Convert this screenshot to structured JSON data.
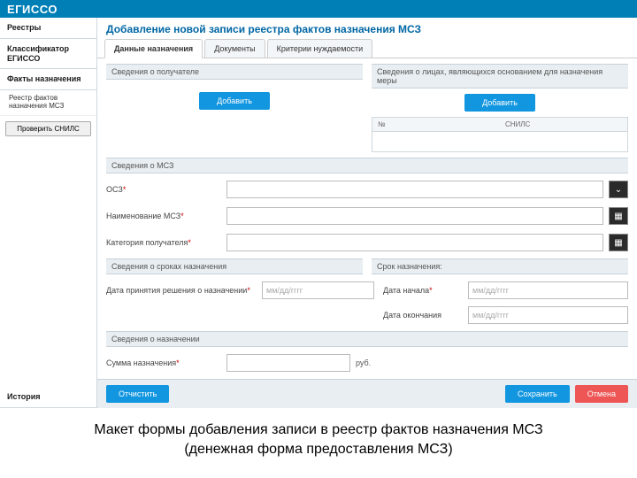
{
  "brand": "ЕГИССО",
  "sidebar": {
    "items": [
      {
        "label": "Реестры"
      },
      {
        "label": "Классификатор ЕГИССО"
      },
      {
        "label": "Факты назначения"
      }
    ],
    "sub_item": "Реестр фактов назначения МСЗ",
    "check_btn": "Проверить СНИЛС",
    "history": "История"
  },
  "page": {
    "title": "Добавление новой записи реестра фактов назначения МСЗ",
    "tabs": [
      "Данные назначения",
      "Документы",
      "Критерии нуждаемости"
    ]
  },
  "sections": {
    "recipient": "Сведения о получателе",
    "persons": "Сведения о лицах, являющихся основанием для назначения меры",
    "msz": "Сведения о МСЗ",
    "terms": "Сведения о сроках назначения",
    "term_right": "Срок назначения:",
    "assign": "Сведения о назначении"
  },
  "buttons": {
    "add_recipient": "Добавить",
    "add_person": "Добавить"
  },
  "persons_table": {
    "col1": "№",
    "col2": "СНИЛС"
  },
  "labels": {
    "osz": "ОСЗ",
    "msz_name": "Наименование МСЗ",
    "recipient_cat": "Категория получателя",
    "decision_date": "Дата принятия решения о назначении",
    "date_start": "Дата начала",
    "date_end": "Дата окончания",
    "amount": "Сумма назначения"
  },
  "placeholders": {
    "date": "мм/дд/гггг"
  },
  "unit_rub": "руб.",
  "footer": {
    "clear": "Отчистить",
    "save": "Сохранить",
    "cancel": "Отмена"
  },
  "caption_line1": "Макет формы добавления записи в реестр фактов назначения МСЗ",
  "caption_line2": "(денежная форма предоставления МСЗ)"
}
